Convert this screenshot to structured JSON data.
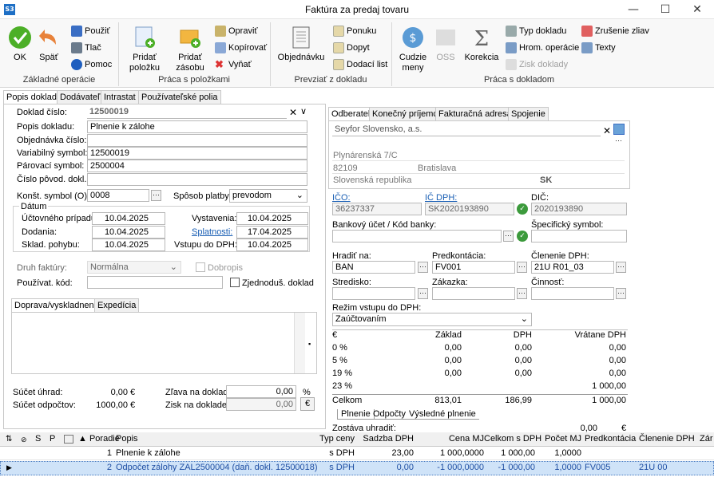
{
  "window": {
    "title": "Faktúra za predaj tovaru",
    "icon": "S3",
    "min": "—",
    "max": "☐",
    "close": "✕"
  },
  "ribbon": {
    "ok": "OK",
    "back": "Späť",
    "use": "Použiť",
    "print": "Tlač",
    "help": "Pomoc",
    "group1": "Základné operácie",
    "add_item": "Pridať položku",
    "add_stock": "Pridať zásobu",
    "edit": "Opraviť",
    "copy": "Kopírovať",
    "cut": "Vyňať",
    "group2": "Práca s položkami",
    "orders": "Objednávku",
    "offer": "Ponuku",
    "inquiry": "Dopyt",
    "delivery": "Dodací list",
    "group3": "Prevziať z dokladu",
    "foreign": "Cudzie meny",
    "oss": "OSS",
    "correction": "Korekcia",
    "doctype": "Typ dokladu",
    "bulk": "Hrom. operácie",
    "profit": "Zisk doklady",
    "cancel_disc": "Zrušenie zliav",
    "texts": "Texty",
    "group4": "Práca s dokladom"
  },
  "tabs_left": [
    "Popis dokladu",
    "Dodávateľ",
    "Intrastat",
    "Používateľské polia"
  ],
  "form": {
    "doc_no_lbl": "Doklad číslo:",
    "doc_no": "12500019",
    "desc_lbl": "Popis dokladu:",
    "desc": "Plnenie k zálohe",
    "order_lbl": "Objednávka číslo:",
    "order": "",
    "vs_lbl": "Variabilný symbol:",
    "vs": "12500019",
    "ps_lbl": "Párovací symbol:",
    "ps": "2500004",
    "orig_lbl": "Číslo pôvod. dokl.:",
    "orig": "",
    "ks_lbl": "Konšt. symbol (O):",
    "ks": "0008",
    "pay_lbl": "Spôsob platby:",
    "pay": "prevodom",
    "dates_lbl": "Dátum",
    "acc_case_lbl": "Účtovného prípadu:",
    "acc_case": "10.04.2025",
    "delivery_lbl": "Dodania:",
    "delivery": "10.04.2025",
    "stock_lbl": "Sklad. pohybu:",
    "stock": "10.04.2025",
    "issue_lbl": "Vystavenia:",
    "issue": "10.04.2025",
    "due_lbl": "Splatnosti:",
    "due": "17.04.2025",
    "vat_in_lbl": "Vstupu do DPH:",
    "vat_in": "10.04.2025",
    "inv_type_lbl": "Druh faktúry:",
    "inv_type": "Normálna",
    "credit_lbl": "Dobropis",
    "user_code_lbl": "Používat. kód:",
    "user_code": "",
    "simpl_lbl": "Zjednoduš. doklad",
    "transport_tab": "Doprava/vyskladnenie",
    "exped_tab": "Expedícia",
    "paid_lbl": "Súčet úhrad:",
    "paid": "0,00",
    "paid_cur": "€",
    "deduct_lbl": "Súčet odpočtov:",
    "deduct": "1000,00",
    "deduct_cur": "€",
    "disc_lbl": "Zľava na doklad:",
    "disc": "0,00",
    "disc_unit": "%",
    "profit_lbl": "Zisk na doklade:",
    "profit": "0,00",
    "profit_cur": "€"
  },
  "tabs_right": [
    "Odberateľ",
    "Konečný príjemca",
    "Fakturačná adresa",
    "Spojenie"
  ],
  "partner": {
    "name": "Seyfor Slovensko, a.s.",
    "street": "Plynárenská 7/C",
    "zip": "82109",
    "city": "Bratislava",
    "country": "Slovenská republika",
    "country_code": "SK",
    "ico_lbl": "IČO:",
    "ico": "36237337",
    "icdph_lbl": "IČ DPH:",
    "icdph": "SK2020193890",
    "dic_lbl": "DIČ:",
    "dic": "2020193890",
    "bank_lbl": "Bankový účet / Kód banky:",
    "spec_lbl": "Špecifický symbol:",
    "pay_to_lbl": "Hradiť na:",
    "pay_to": "BAN",
    "precont_lbl": "Predkontácia:",
    "precont": "FV001",
    "vatsplit_lbl": "Členenie DPH:",
    "vatsplit": "21U R01_03",
    "center_lbl": "Stredisko:",
    "job_lbl": "Zákazka:",
    "activity_lbl": "Činnosť:",
    "vat_mode_lbl": "Režim vstupu do DPH:",
    "vat_mode": "Zaúčtovaním"
  },
  "vat_table": {
    "headers": [
      "€",
      "Základ",
      "DPH",
      "Vrátane DPH"
    ],
    "rows": [
      [
        "0 %",
        "0,00",
        "0,00",
        "0,00"
      ],
      [
        "5 %",
        "0,00",
        "0,00",
        "0,00"
      ],
      [
        "19 %",
        "0,00",
        "0,00",
        "0,00"
      ],
      [
        "23 %",
        "",
        "",
        "1 000,00"
      ]
    ],
    "total": [
      "Celkom",
      "813,01",
      "186,99",
      "1 000,00"
    ],
    "subtabs": [
      "Plnenie",
      "Odpočty",
      "Výsledné plnenie"
    ],
    "remain_lbl": "Zostáva uhradiť:",
    "remain": "0,00",
    "remain_cur": "€"
  },
  "items": {
    "headers": [
      "S",
      "P",
      "Poradie",
      "Popis",
      "Typ ceny",
      "Sadzba DPH",
      "Cena MJ",
      "Celkom s DPH",
      "Počet MJ",
      "Predkontácia",
      "Členenie DPH",
      "Zár"
    ],
    "rows": [
      [
        "1",
        "Plnenie k zálohe",
        "s DPH",
        "23,00",
        "1 000,0000",
        "1 000,00",
        "1,0000",
        "",
        ""
      ],
      [
        "2",
        "Odpočet zálohy ZAL2500004 (daň. dokl. 12500018)",
        "s DPH",
        "0,00",
        "-1 000,0000",
        "-1 000,00",
        "1,0000",
        "FV005",
        "21U 00"
      ]
    ]
  }
}
